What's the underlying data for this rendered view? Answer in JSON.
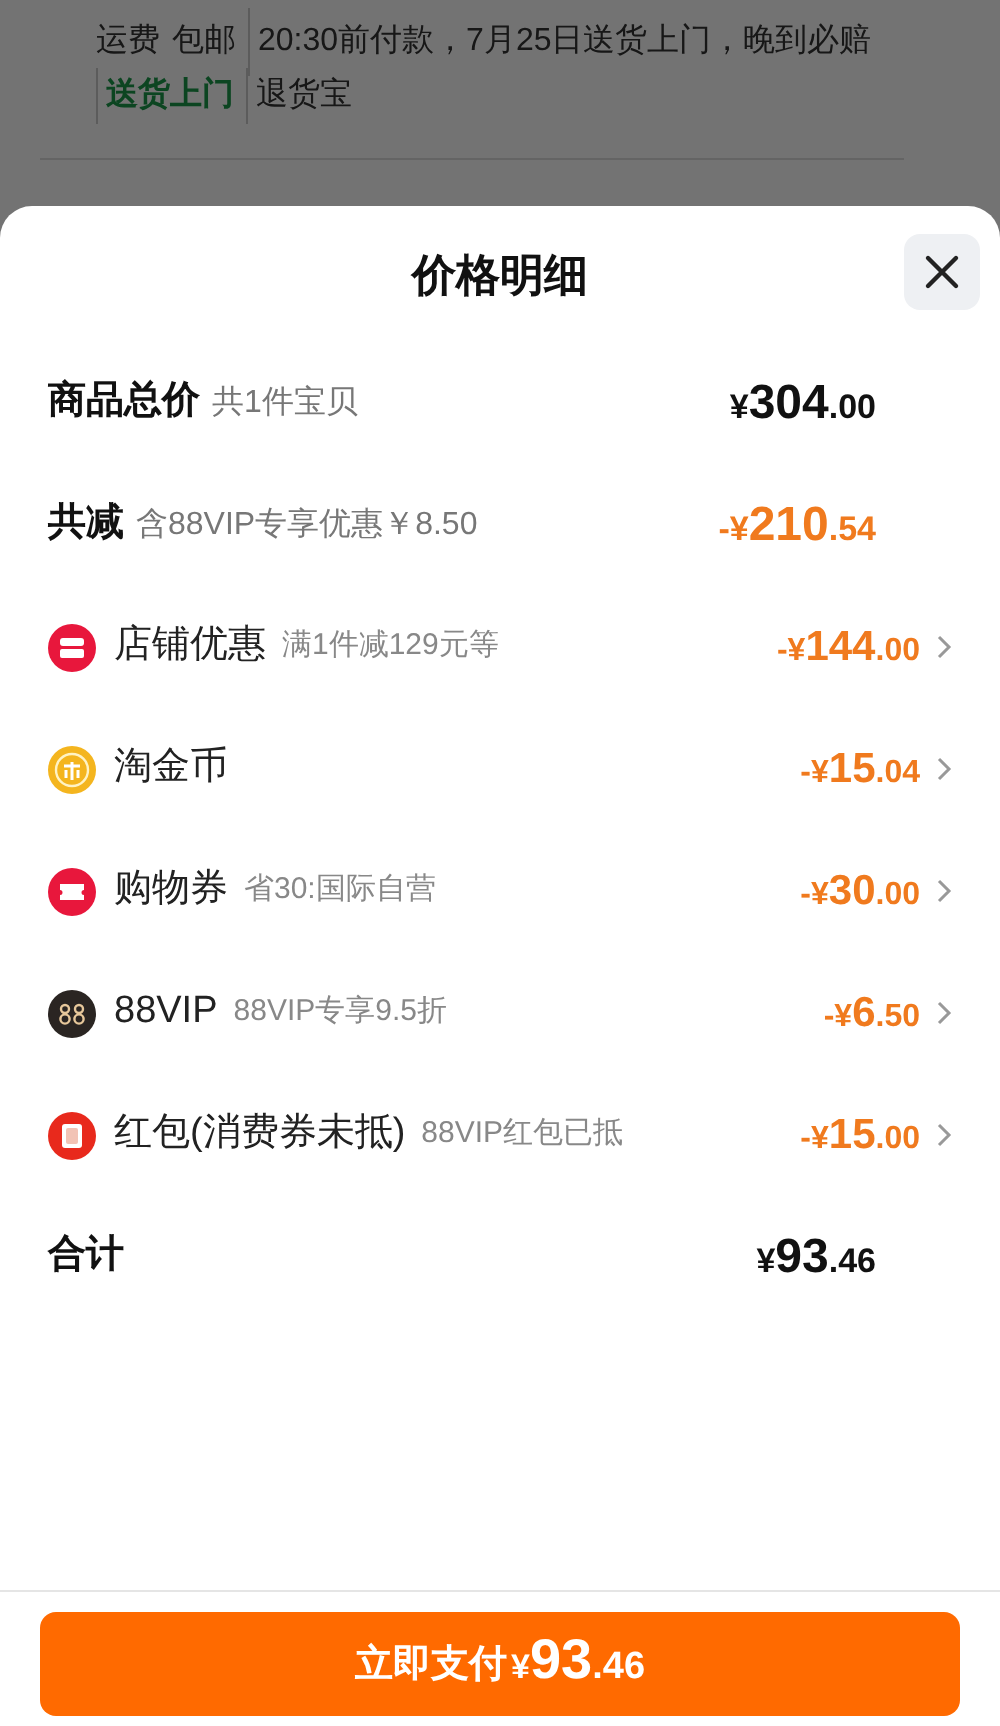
{
  "background": {
    "shipping_label": "运费",
    "shipping_value": "包邮",
    "delivery_note": "20:30前付款，7月25日送货上门，晚到必赔",
    "tags": [
      "送货上门",
      "退货宝"
    ]
  },
  "sheet": {
    "title": "价格明细",
    "rows": [
      {
        "kind": "summary",
        "label": "商品总价",
        "note": "共1件宝贝",
        "amount": "¥304.00",
        "highlight": false
      },
      {
        "kind": "summary",
        "label": "共减",
        "note": "含88VIP专享优惠￥8.50",
        "amount": "-¥210.54",
        "highlight": true
      },
      {
        "kind": "discount",
        "label": "店铺优惠",
        "note": "满1件减129元等",
        "amount": "-¥144.00",
        "highlight": true
      },
      {
        "kind": "discount",
        "label": "淘金币",
        "amount": "-¥15.04",
        "highlight": true
      },
      {
        "kind": "discount",
        "label": "购物券",
        "note": "省30:国际自营",
        "amount": "-¥30.00",
        "highlight": true
      },
      {
        "kind": "discount",
        "label": "88VIP",
        "note": "88VIP专享9.5折",
        "amount": "-¥6.50",
        "highlight": true
      },
      {
        "kind": "discount",
        "label": "红包(消费券未抵)",
        "note": "88VIP红包已抵",
        "amount": "-¥15.00",
        "highlight": true
      },
      {
        "kind": "summary",
        "label": "合计",
        "amount": "¥93.46",
        "highlight": false
      }
    ],
    "pay_button": {
      "label": "立即支付",
      "amount": "¥93.46"
    }
  }
}
